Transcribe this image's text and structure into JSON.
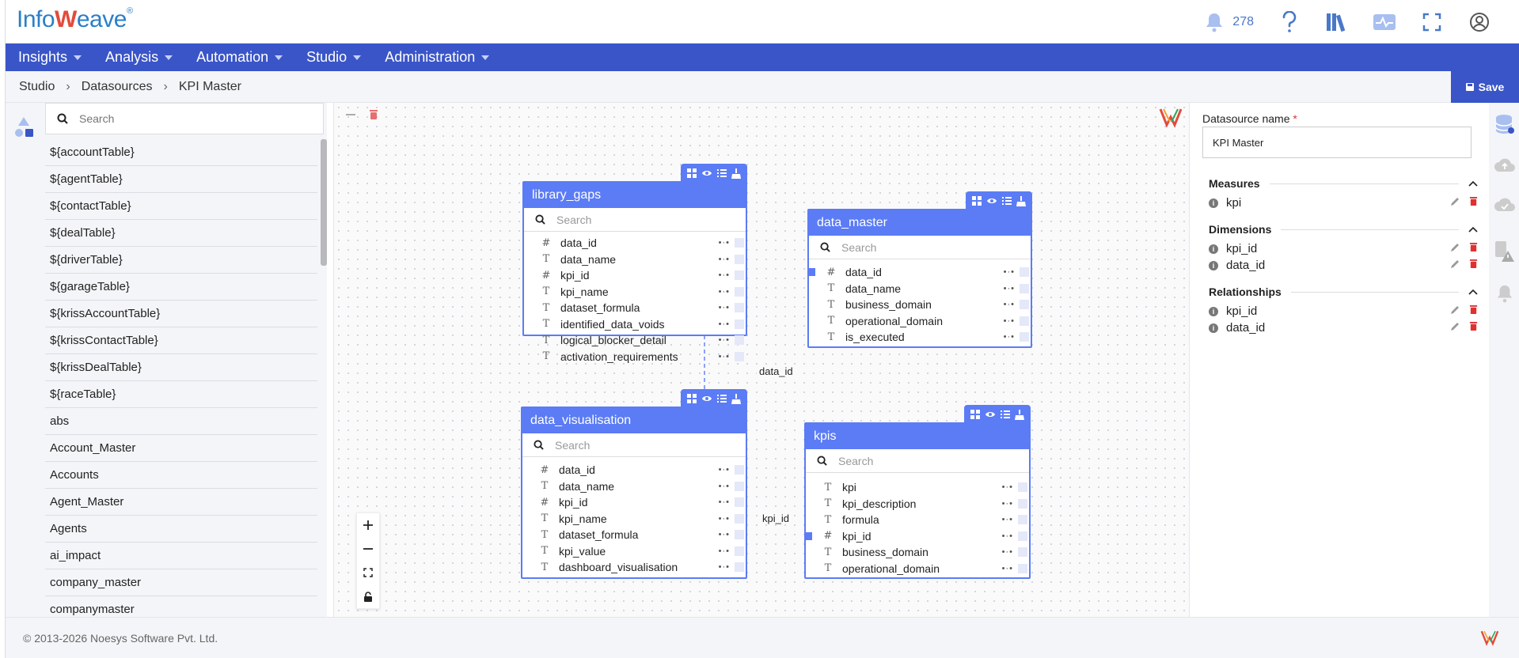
{
  "app": {
    "logo_prefix": "Info",
    "logo_suffix": "eave",
    "logo_mark": "W"
  },
  "header": {
    "notification_count": "278",
    "icons": [
      "bell-icon",
      "help-icon",
      "library-icon",
      "activity-icon",
      "fullscreen-icon",
      "user-icon"
    ]
  },
  "nav": {
    "items": [
      {
        "label": "Insights"
      },
      {
        "label": "Analysis"
      },
      {
        "label": "Automation"
      },
      {
        "label": "Studio"
      },
      {
        "label": "Administration"
      }
    ]
  },
  "breadcrumb": {
    "items": [
      "Studio",
      "Datasources",
      "KPI Master"
    ]
  },
  "toolbar": {
    "save_label": "Save"
  },
  "left_panel": {
    "search_placeholder": "Search",
    "items": [
      "${accountTable}",
      "${agentTable}",
      "${contactTable}",
      "${dealTable}",
      "${driverTable}",
      "${garageTable}",
      "${krissAccountTable}",
      "${krissContactTable}",
      "${krissDealTable}",
      "${raceTable}",
      "abs",
      "Account_Master",
      "Accounts",
      "Agent_Master",
      "Agents",
      "ai_impact",
      "company_master",
      "companymaster"
    ]
  },
  "canvas": {
    "tables": {
      "library_gaps": {
        "title": "library_gaps",
        "search_placeholder": "Search",
        "fields": [
          {
            "type": "#",
            "name": "data_id"
          },
          {
            "type": "T",
            "name": "data_name"
          },
          {
            "type": "#",
            "name": "kpi_id"
          },
          {
            "type": "T",
            "name": "kpi_name"
          },
          {
            "type": "T",
            "name": "dataset_formula"
          },
          {
            "type": "T",
            "name": "identified_data_voids"
          },
          {
            "type": "T",
            "name": "logical_blocker_detail"
          },
          {
            "type": "T",
            "name": "activation_requirements"
          }
        ]
      },
      "data_master": {
        "title": "data_master",
        "search_placeholder": "Search",
        "fields": [
          {
            "type": "#",
            "name": "data_id"
          },
          {
            "type": "T",
            "name": "data_name"
          },
          {
            "type": "T",
            "name": "business_domain"
          },
          {
            "type": "T",
            "name": "operational_domain"
          },
          {
            "type": "T",
            "name": "is_executed"
          }
        ]
      },
      "data_visualisation": {
        "title": "data_visualisation",
        "search_placeholder": "Search",
        "fields": [
          {
            "type": "#",
            "name": "data_id"
          },
          {
            "type": "T",
            "name": "data_name"
          },
          {
            "type": "#",
            "name": "kpi_id"
          },
          {
            "type": "T",
            "name": "kpi_name"
          },
          {
            "type": "T",
            "name": "dataset_formula"
          },
          {
            "type": "T",
            "name": "kpi_value"
          },
          {
            "type": "T",
            "name": "dashboard_visualisation"
          }
        ]
      },
      "kpis": {
        "title": "kpis",
        "search_placeholder": "Search",
        "fields": [
          {
            "type": "T",
            "name": "kpi"
          },
          {
            "type": "T",
            "name": "kpi_description"
          },
          {
            "type": "T",
            "name": "formula"
          },
          {
            "type": "#",
            "name": "kpi_id"
          },
          {
            "type": "T",
            "name": "business_domain"
          },
          {
            "type": "T",
            "name": "operational_domain"
          }
        ]
      }
    },
    "relationship_labels": {
      "data_id": "data_id",
      "kpi_id": "kpi_id"
    },
    "zoom_controls": [
      "+",
      "−",
      "fit",
      "lock"
    ]
  },
  "right_panel": {
    "datasource_label": "Datasource name",
    "required_mark": "*",
    "datasource_name": "KPI Master",
    "measures": {
      "title": "Measures",
      "items": [
        "kpi"
      ]
    },
    "dimensions": {
      "title": "Dimensions",
      "items": [
        "kpi_id",
        "data_id"
      ]
    },
    "relationships": {
      "title": "Relationships",
      "items": [
        "kpi_id",
        "data_id"
      ]
    }
  },
  "footer": {
    "copyright": "© 2013-2026 Noesys Software Pvt. Ltd."
  },
  "colors": {
    "nav": "#3a55c8",
    "table_header": "#5b7cf5",
    "delete": "#e03030"
  }
}
